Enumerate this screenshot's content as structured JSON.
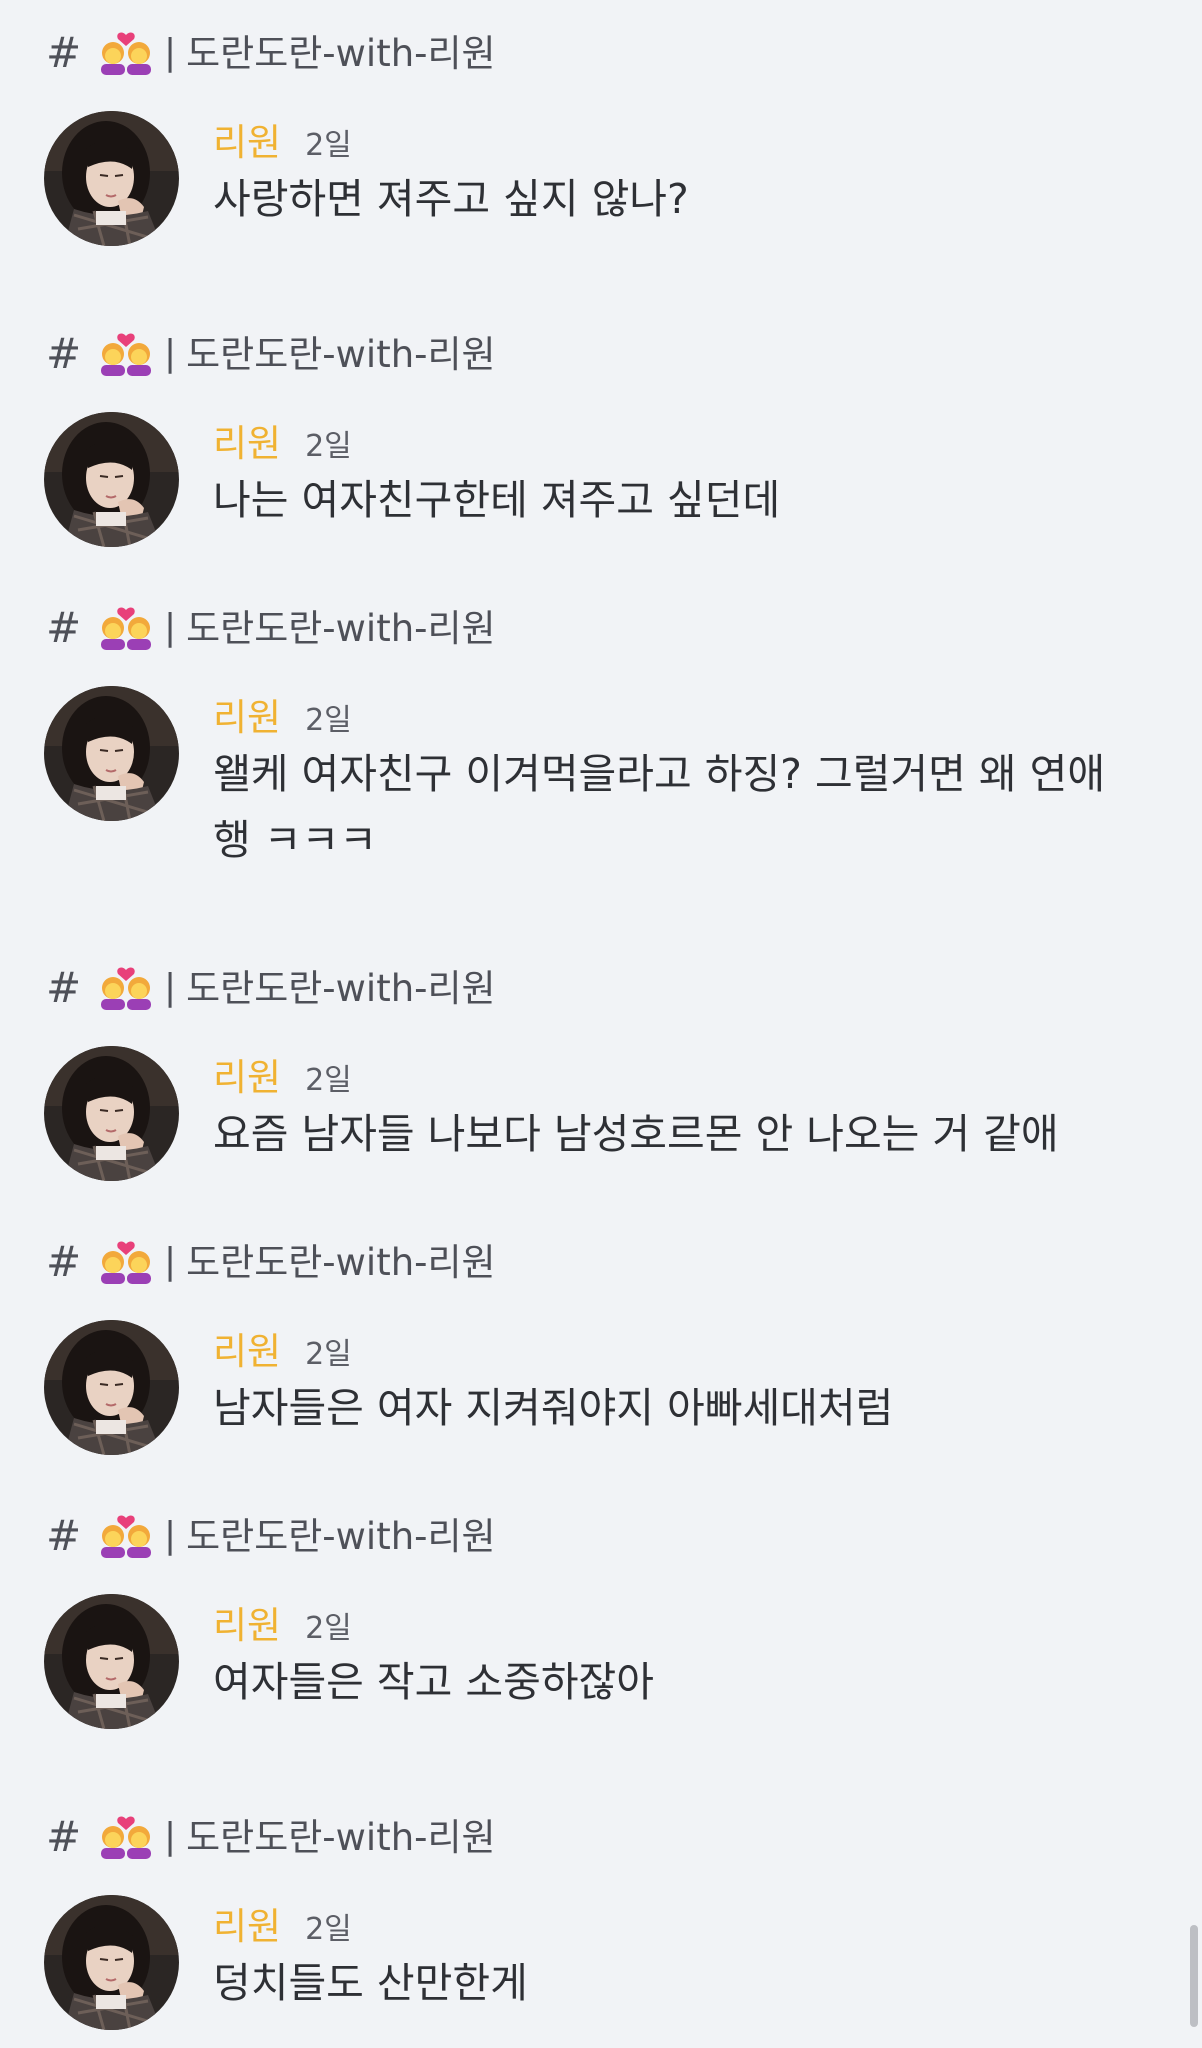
{
  "messages": [
    {
      "channel": {
        "hash": "#",
        "separator": "|",
        "name": "도란도란-with-리원"
      },
      "author": "리원",
      "time": "2일",
      "text": "사랑하면 져주고 싶지 않나?"
    },
    {
      "channel": {
        "hash": "#",
        "separator": "|",
        "name": "도란도란-with-리원"
      },
      "author": "리원",
      "time": "2일",
      "text": "나는 여자친구한테 져주고 싶던데"
    },
    {
      "channel": {
        "hash": "#",
        "separator": "|",
        "name": "도란도란-with-리원"
      },
      "author": "리원",
      "time": "2일",
      "text": "왤케 여자친구 이겨먹을라고 하징? 그럴거면 왜 연애\n행 ㅋㅋㅋ"
    },
    {
      "channel": {
        "hash": "#",
        "separator": "|",
        "name": "도란도란-with-리원"
      },
      "author": "리원",
      "time": "2일",
      "text": "요즘 남자들 나보다 남성호르몬 안 나오는 거 같애"
    },
    {
      "channel": {
        "hash": "#",
        "separator": "|",
        "name": "도란도란-with-리원"
      },
      "author": "리원",
      "time": "2일",
      "text": "남자들은 여자 지켜줘야지 아빠세대처럼"
    },
    {
      "channel": {
        "hash": "#",
        "separator": "|",
        "name": "도란도란-with-리원"
      },
      "author": "리원",
      "time": "2일",
      "text": "여자들은 작고 소중하잖아"
    },
    {
      "channel": {
        "hash": "#",
        "separator": "|",
        "name": "도란도란-with-리원"
      },
      "author": "리원",
      "time": "2일",
      "text": "덩치들도 산만한게"
    }
  ],
  "icons": {
    "channel": "couple-with-heart-woman-woman-emoji-icon",
    "avatar": "user-avatar-photo"
  },
  "colors": {
    "background": "#f1f3f6",
    "author": "#f0b232",
    "text": "#2e3035",
    "muted": "#5c5e66"
  }
}
